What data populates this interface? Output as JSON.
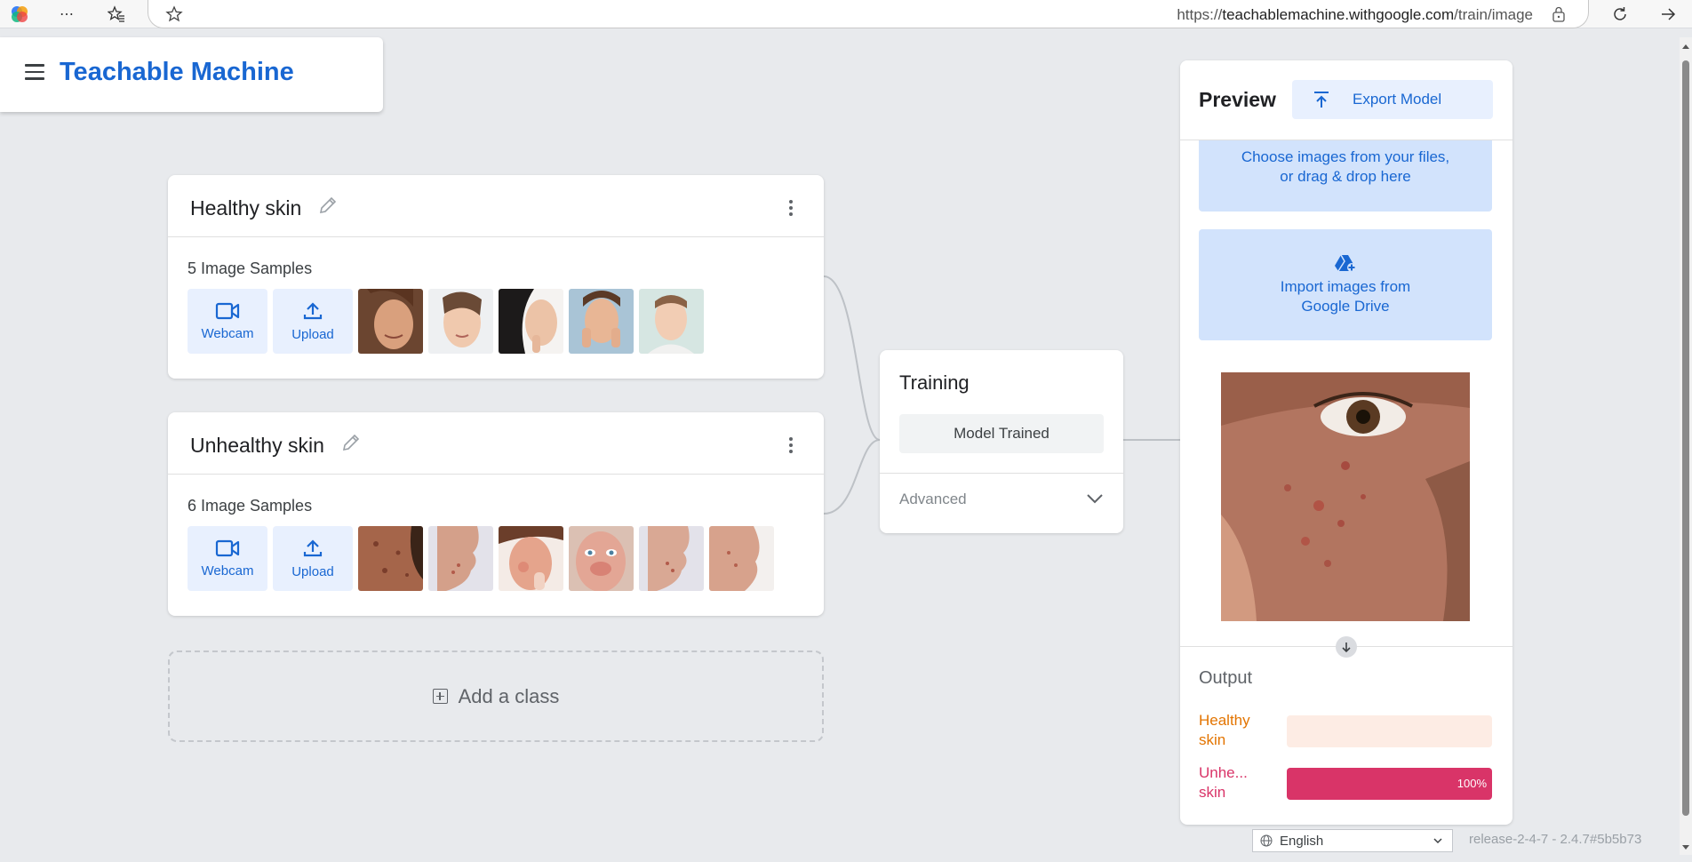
{
  "browser": {
    "url_prefix": "https://",
    "url_host": "teachablemachine.withgoogle.com",
    "url_path": "/train/image"
  },
  "app": {
    "title": "Teachable Machine"
  },
  "classes": [
    {
      "name": "Healthy skin",
      "count_label": "5 Image Samples",
      "webcam_label": "Webcam",
      "upload_label": "Upload",
      "thumbnails": [
        "face-smiling",
        "face-neutral",
        "face-side",
        "face-hands",
        "face-portrait"
      ]
    },
    {
      "name": "Unhealthy skin",
      "count_label": "6 Image Samples",
      "webcam_label": "Webcam",
      "upload_label": "Upload",
      "thumbnails": [
        "skin-closeup",
        "face-profile",
        "face-redness",
        "face-rosacea",
        "face-profile-2",
        "cheek-closeup"
      ]
    }
  ],
  "add_class_label": "Add a class",
  "training": {
    "title": "Training",
    "button_label": "Model Trained",
    "advanced_label": "Advanced"
  },
  "preview": {
    "title": "Preview",
    "export_label": "Export Model",
    "drop_line1": "Choose images from your files,",
    "drop_line2": "or drag & drop here",
    "drive_line1": "Import images from",
    "drive_line2": "Google Drive",
    "output_title": "Output",
    "outputs": [
      {
        "label_line1": "Healthy",
        "label_line2": "skin",
        "percent_label": "",
        "value": 0.0,
        "color": "#e37400",
        "track": "#fdece4"
      },
      {
        "label_line1": "Unhe...",
        "label_line2": "skin",
        "percent_label": "100%",
        "value": 1.0,
        "color": "#d93468",
        "track": "#fbe3ea"
      }
    ]
  },
  "footer": {
    "language": "English",
    "release": "release-2-4-7 - 2.4.7#5b5b73"
  },
  "colors": {
    "accent": "#1967d2",
    "light_accent": "#e8f0fe",
    "drop_zone": "#d2e3fc"
  }
}
